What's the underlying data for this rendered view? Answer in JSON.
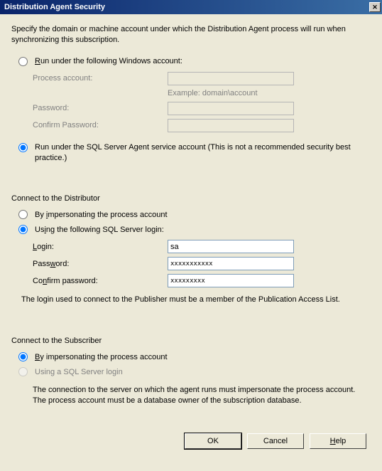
{
  "title": "Distribution Agent Security",
  "intro": "Specify the domain or machine account under which the Distribution Agent process will run when synchronizing this subscription.",
  "section1": {
    "opt1": {
      "pre": "R",
      "text": "un under the following Windows account:",
      "process_label": "Process account:",
      "example": "Example: domain\\account",
      "password_label": "Password:",
      "confirm_label": "Confirm Password:"
    },
    "opt2": {
      "text": "Run under the SQL Server Agent service account (This is not a recommended security best practice.)"
    }
  },
  "distributor": {
    "header": "Connect to the Distributor",
    "opt1": {
      "pre": "By ",
      "u": "i",
      "post": "mpersonating the process account"
    },
    "opt2": {
      "pre": "Us",
      "u": "i",
      "post": "ng the following SQL Server login:"
    },
    "login_label_u": "L",
    "login_label_post": "ogin:",
    "login_value": "sa",
    "password_label_pre": "Pass",
    "password_label_u": "w",
    "password_label_post": "ord:",
    "password_value": "xxxxxxxxxxx",
    "confirm_label_pre": "Co",
    "confirm_label_u": "n",
    "confirm_label_post": "firm password:",
    "confirm_value": "xxxxxxxxx",
    "note": "The login used to connect to the Publisher must be a member of the Publication Access List."
  },
  "subscriber": {
    "header": "Connect to the Subscriber",
    "opt1": {
      "u": "B",
      "post": "y impersonating the process account"
    },
    "opt2": "Using a SQL Server login",
    "note": "The connection to the server on which the agent runs must impersonate the process account. The process account must be a database owner of the subscription database."
  },
  "buttons": {
    "ok": "OK",
    "cancel": "Cancel",
    "help_u": "H",
    "help_post": "elp"
  }
}
